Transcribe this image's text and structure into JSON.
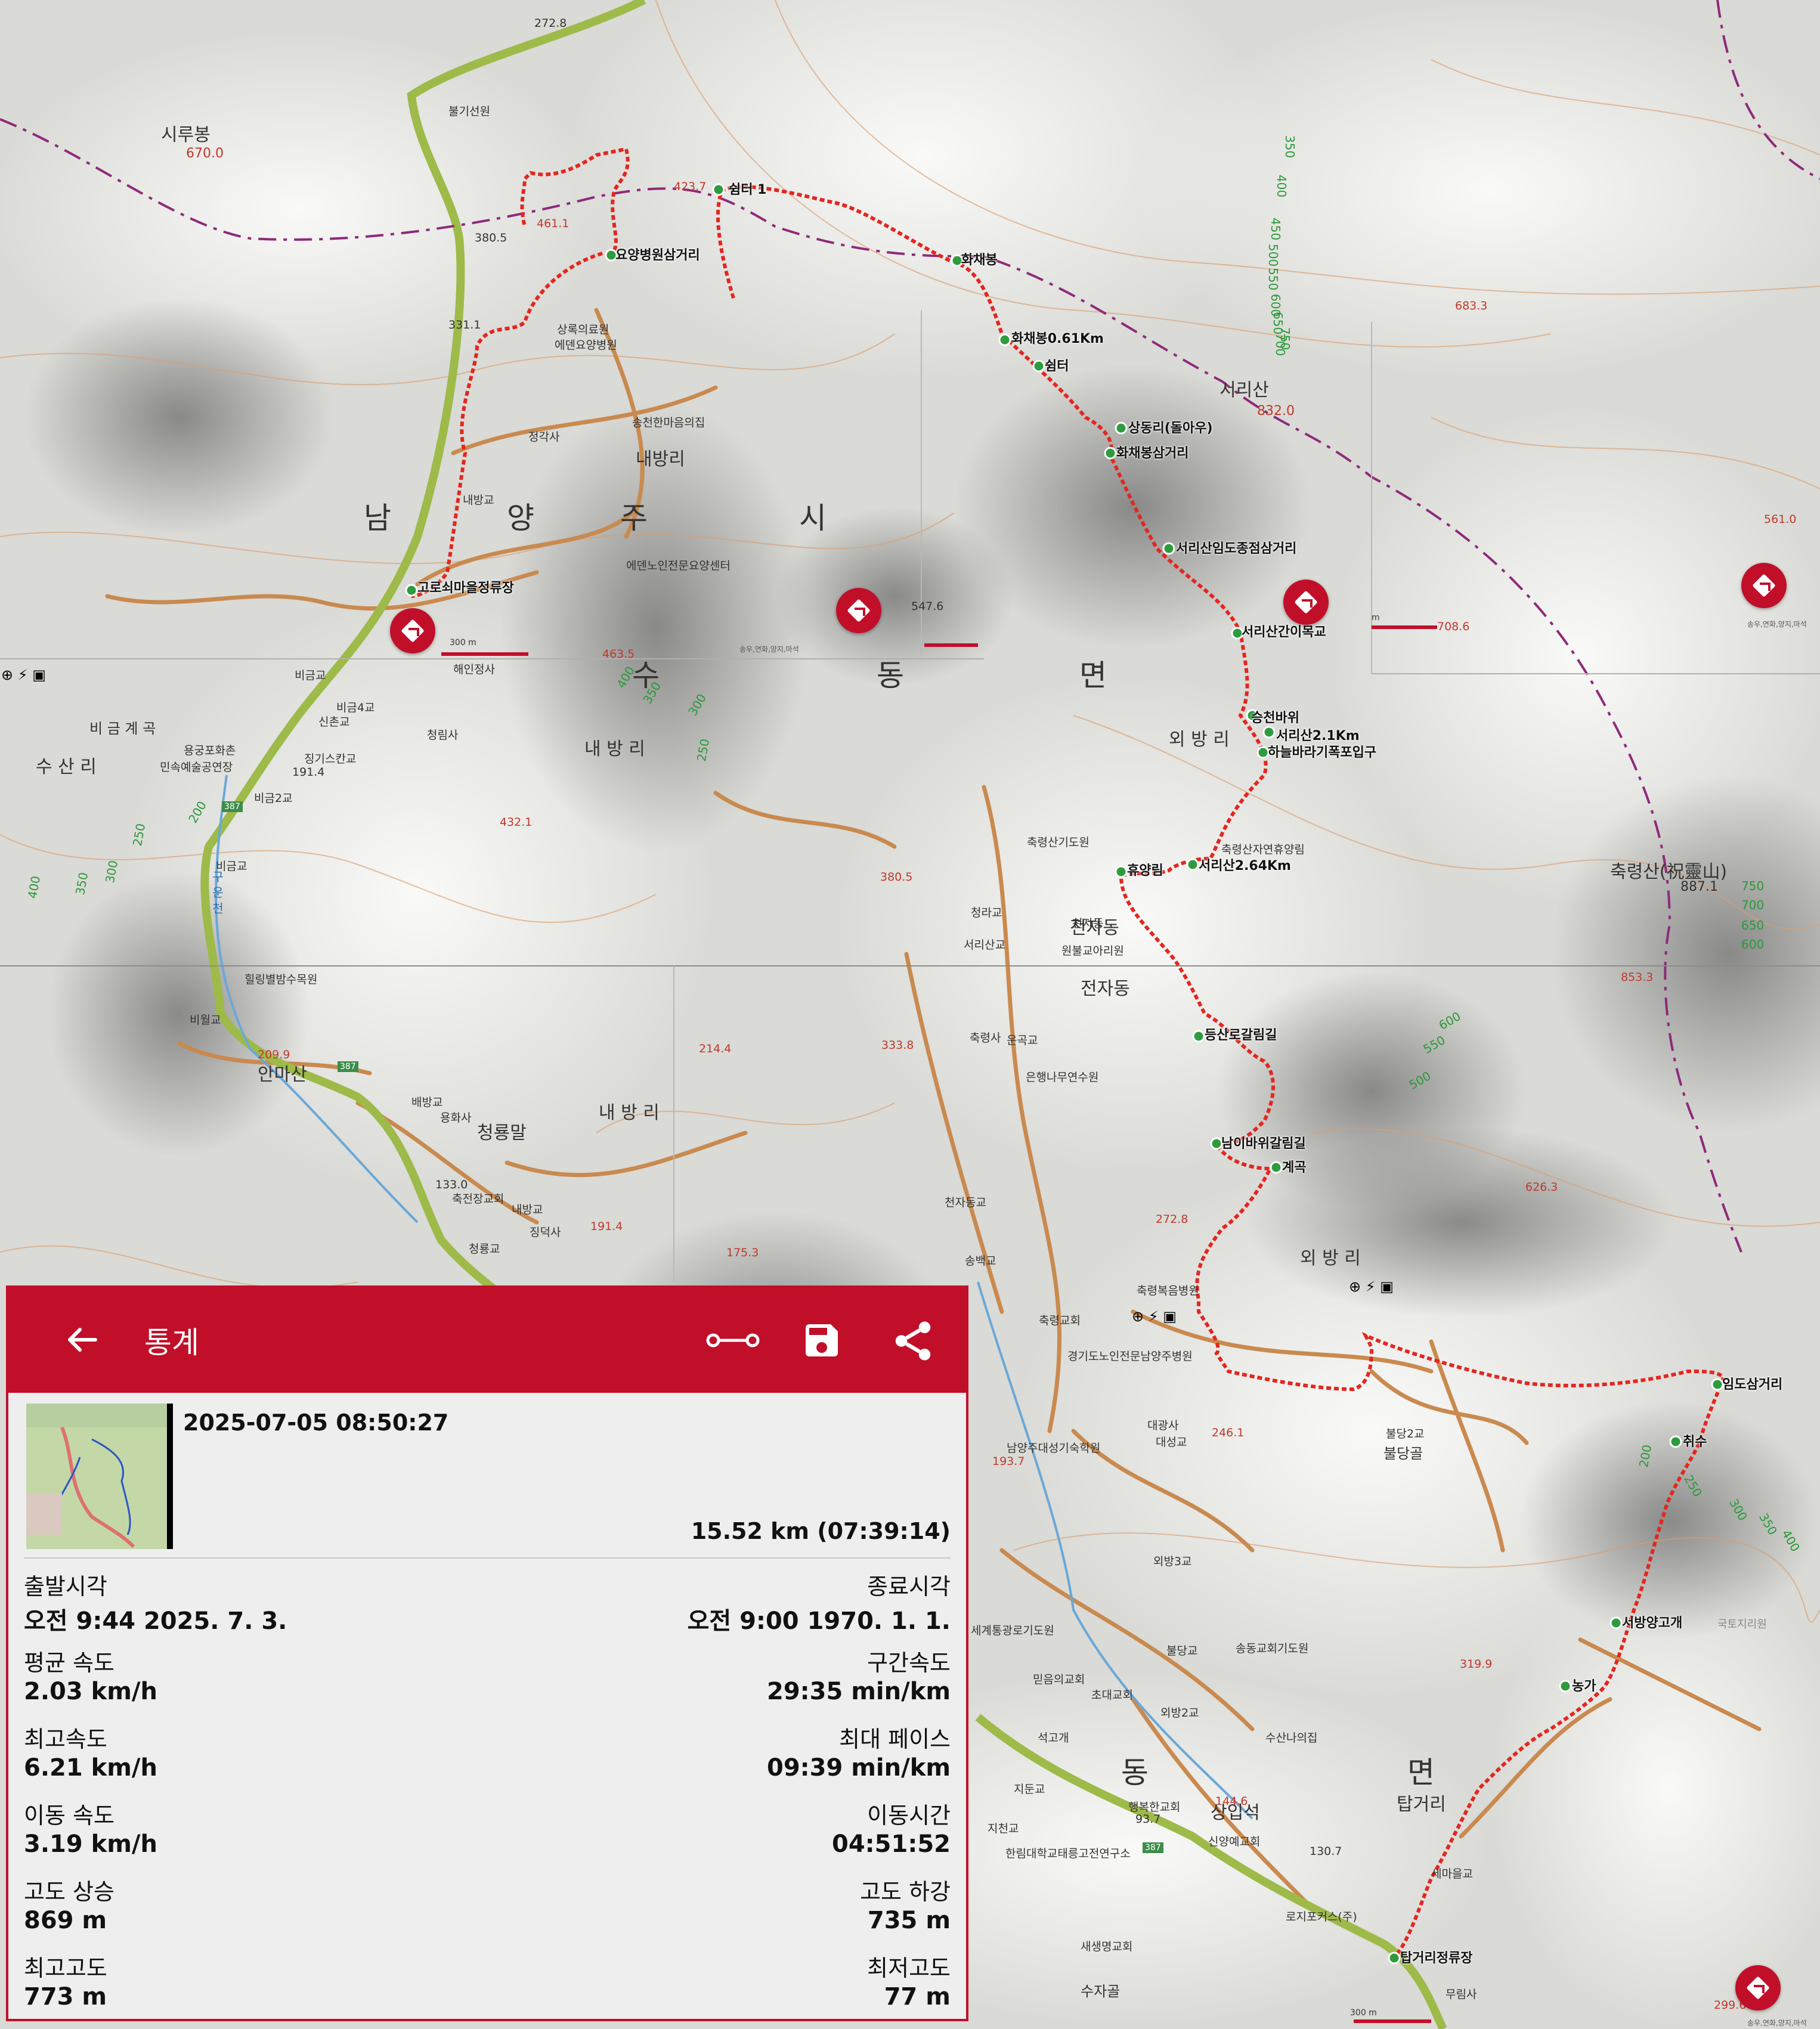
{
  "map": {
    "places": {
      "sirubong": "시루봉",
      "sirubong_el": "670.0",
      "seorisan": "서리산",
      "seorisan_el": "832.0",
      "chungnyeongsan": "축령산(祝靈山)",
      "chungnyeongsan_el": "887.1",
      "namyangju": [
        "남",
        "양",
        "주",
        "시"
      ],
      "sudong": [
        "수",
        "동",
        "면"
      ],
      "dong2": [
        "동",
        "면"
      ],
      "naebangri1": "내방리",
      "naebangri2": "내 방 리",
      "naebangri3": "내 방 리",
      "oebangri1": "외 방 리",
      "oebangri2": "외 방 리",
      "susanri": "수 산 리",
      "jeonjadong": "전자동",
      "jeonjadong2": "전자동",
      "sangibseok": "상입석",
      "tapgeori": "탑거리",
      "anmasan": "안마산",
      "cheongnyongmal": "청룡말",
      "bigeumgyegok": "비 금 계 곡",
      "bulganggol": "불당골"
    },
    "elevations": [
      "272.8",
      "380.5",
      "331.1",
      "461.1",
      "423.7",
      "683.3",
      "561.0",
      "708.6",
      "463.5",
      "547.6",
      "432.1",
      "380.5",
      "191.4",
      "209.9",
      "214.4",
      "333.8",
      "175.3",
      "191.4",
      "133.0",
      "272.8",
      "626.3",
      "853.3",
      "246.1",
      "193.7",
      "319.9",
      "144.6",
      "93.7",
      "130.7",
      "299.6"
    ],
    "waypoints": [
      "쉼터 1",
      "화채봉",
      "화채봉0.61Km",
      "쉼터",
      "상동리(돌아우)",
      "화채봉삼거리",
      "서리산임도종점삼거리",
      "서리산간이목교",
      "승천바위",
      "서리산2.1Km",
      "하늘바라기폭포입구",
      "서리산2.64Km",
      "휴양림",
      "등산로갈림길",
      "남이바위갈림길",
      "계곡",
      "임도삼거리",
      "취수",
      "서방양고개",
      "농가",
      "탑거리정류장",
      "요양병원삼거리",
      "고로쇠마을정류장"
    ],
    "labels": [
      "불기선원",
      "상록의료원",
      "에덴요양병원",
      "송천한마음의집",
      "정각사",
      "내방교",
      "에덴노인전문요양센터",
      "해인정사",
      "청림사",
      "비금교",
      "비금4교",
      "신촌교",
      "용궁포화촌",
      "민속예술공연장",
      "징기스칸교",
      "비금2교",
      "비금교",
      "힐링별밤수목원",
      "비월교",
      "배방교",
      "용화사",
      "축전장교회",
      "내방교",
      "청룡교",
      "징덕사",
      "축령산기도원",
      "청라교",
      "서리산교",
      "천자동",
      "원불교아리원",
      "축령사",
      "운곡교",
      "은행나무연수원",
      "천자동교",
      "송백교",
      "축령복음병원",
      "축령교회",
      "경기도노인전문남양주병원",
      "대광사",
      "대성교",
      "남양주대성기숙학원",
      "외방3교",
      "불당2교",
      "세계통광로기도원",
      "불당교",
      "송동교회기도원",
      "믿음의교회",
      "초대교회",
      "외방2교",
      "석고개",
      "지둔교",
      "행복한교회",
      "수산나의집",
      "신양예교회",
      "한림대학교태릉고전연구소",
      "지천교",
      "로지포커스(주)",
      "세마을교",
      "무림사",
      "새생명교회",
      "수자골",
      "축령산자연휴양림"
    ],
    "scale_labels": [
      "300 m",
      "m",
      "300 m"
    ],
    "road_shields": [
      "387",
      "387",
      "387"
    ],
    "stream_label": "구 운 천",
    "contours": [
      "350",
      "400",
      "450",
      "500",
      "550",
      "600",
      "650",
      "700",
      "750",
      "200",
      "250",
      "300",
      "350",
      "400",
      "500",
      "550",
      "600",
      "650",
      "700",
      "750",
      "200",
      "250",
      "300",
      "350",
      "400",
      "400",
      "350",
      "300",
      "250",
      "200",
      "250",
      "300",
      "400"
    ],
    "watermark": "국토지리원",
    "pin_captions": [
      "송우,연화,양지,마석",
      "송우,연화,양지,마석",
      "송우,연화,양지,마석"
    ],
    "colors": {
      "track": "#e4261f",
      "road": "#c98a4f",
      "primary_road": "#9eba49",
      "boundary": "#8d2a7a",
      "accent": "#c10f2a",
      "contour": "#d9a070",
      "contour_label": "#2a9a3a"
    }
  },
  "panel": {
    "title": "통계",
    "back_icon": "arrow-left-icon",
    "actions": [
      "split-icon",
      "save-icon",
      "share-icon"
    ],
    "datetime": "2025-07-05 08:50:27",
    "distance_time": "15.52 km (07:39:14)",
    "stats": [
      {
        "label_l": "출발시각",
        "value_l": "오전 9:44 2025. 7. 3.",
        "label_r": "종료시각",
        "value_r": "오전 9:00 1970. 1. 1."
      },
      {
        "label_l": "평균 속도",
        "value_l": "2.03 km/h",
        "label_r": "구간속도",
        "value_r": "29:35 min/km"
      },
      {
        "label_l": "최고속도",
        "value_l": "6.21 km/h",
        "label_r": "최대 페이스",
        "value_r": "09:39 min/km"
      },
      {
        "label_l": "이동 속도",
        "value_l": "3.19 km/h",
        "label_r": "이동시간",
        "value_r": "04:51:52"
      },
      {
        "label_l": "고도 상승",
        "value_l": "869 m",
        "label_r": "고도 하강",
        "value_r": "735 m"
      },
      {
        "label_l": "최고고도",
        "value_l": "773 m",
        "label_r": "최저고도",
        "value_r": "77 m"
      }
    ]
  }
}
